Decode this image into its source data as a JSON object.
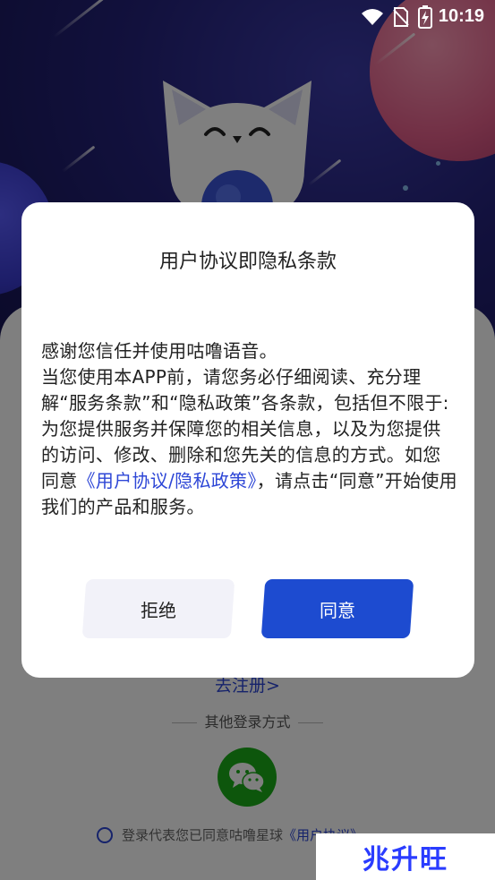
{
  "status_bar": {
    "time": "10:19",
    "icons": [
      "wifi-icon",
      "no-sim-icon",
      "battery-charging-icon"
    ]
  },
  "dialog": {
    "title": "用户协议即隐私条款",
    "body": {
      "p1": "感谢您信任并使用咕噜语音。",
      "p2_before_link": "当您使用本APP前，请您务必仔细阅读、充分理解“服务条款”和“隐私政策”各条款，包括但不限于: 为您提供服务并保障您的相关信息，以及为您提供的访问、修改、删除和您先关的信息的方式。如您同意",
      "link": "《用户协议/隐私政策》",
      "p2_after_link": "，请点击“同意”开始使用我们的产品和服务。"
    },
    "reject_label": "拒绝",
    "agree_label": "同意"
  },
  "login": {
    "register_link": "去注册>",
    "other_login_label": "其他登录方式",
    "agree_text": "登录代表您已同意咕噜星球",
    "agree_link": "《用户协议》"
  },
  "watermark": "兆升旺",
  "colors": {
    "accent": "#1d4bd0",
    "link": "#2d46d6",
    "wechat": "#1aad19",
    "space_bg": "#24227a",
    "planet_pink": "#e5608b"
  }
}
